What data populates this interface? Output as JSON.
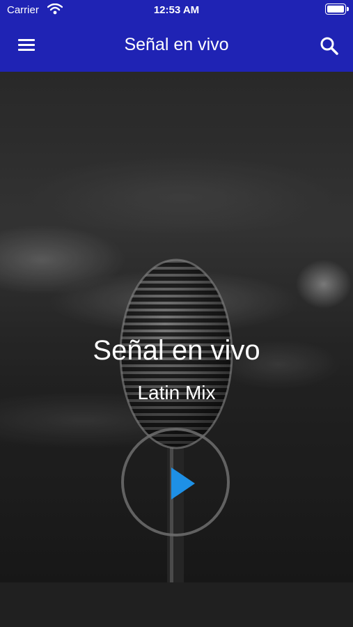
{
  "status_bar": {
    "carrier": "Carrier",
    "time": "12:53 AM"
  },
  "header": {
    "title": "Señal en vivo",
    "menu_icon": "hamburger-menu-icon",
    "search_icon": "search-icon"
  },
  "player": {
    "station_title": "Señal en vivo",
    "station_subtitle": "Latin Mix",
    "play_icon": "play-icon",
    "background_image": "vintage microphone"
  },
  "colors": {
    "header_bg": "#1f23b4",
    "play_accent": "#1e90e6",
    "text": "#ffffff"
  }
}
